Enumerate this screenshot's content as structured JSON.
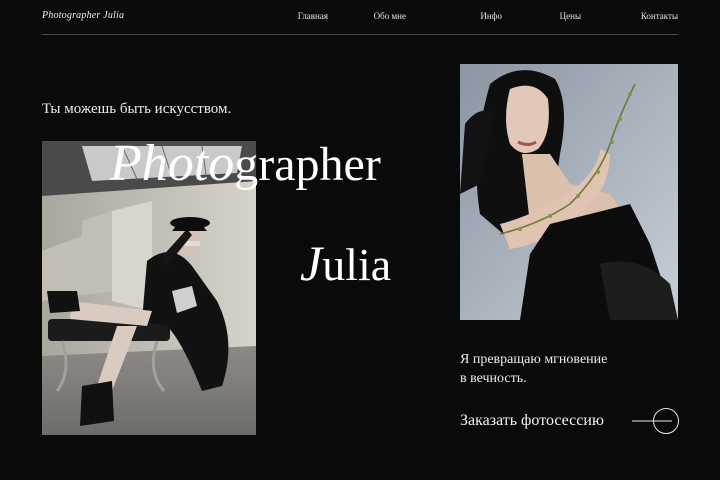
{
  "header": {
    "logo": "Photographer Julia",
    "nav": [
      "Главная",
      "Обо мне",
      "Инфо",
      "Цены",
      "Контакты"
    ]
  },
  "hero": {
    "tagline": "Ты можешь быть искусством.",
    "title_script_1": "Photo",
    "title_rest_1": "grapher",
    "title_script_2": "J",
    "title_rest_2": "ulia"
  },
  "right": {
    "desc_line1": "Я превращаю мгновение",
    "desc_line2": "в вечность.",
    "cta_label": "Заказать фотосессию"
  },
  "colors": {
    "background": "#0a0a0a",
    "text": "#f2f2f2",
    "divider": "#404040"
  },
  "icons": {
    "cta": "arrow-circle-icon"
  }
}
